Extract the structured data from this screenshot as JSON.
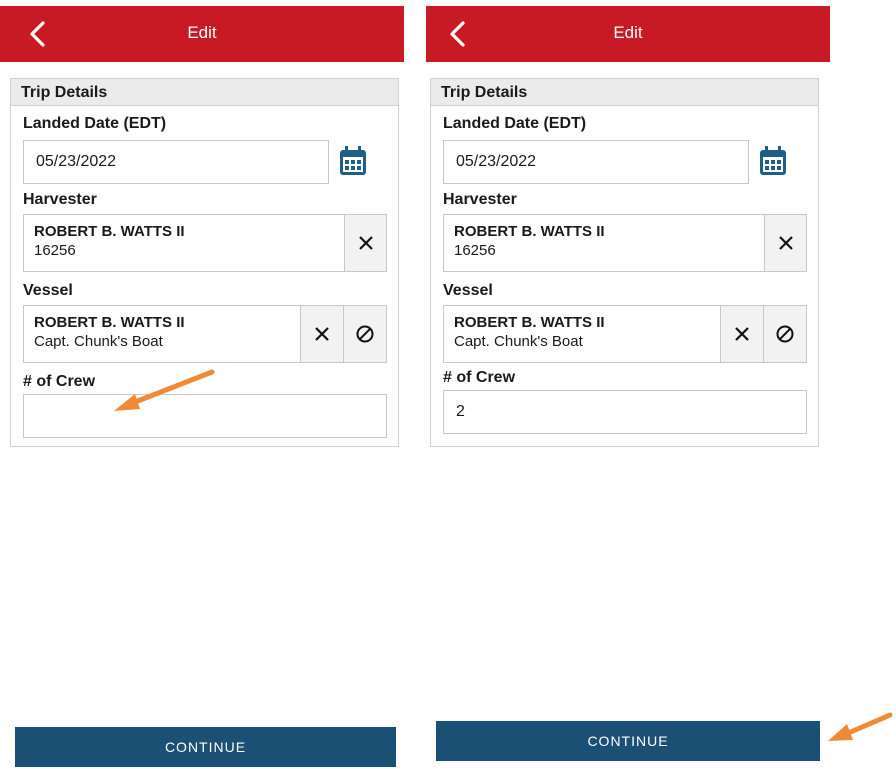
{
  "colors": {
    "header": "#c81a24",
    "continue": "#1b4f73",
    "calendar": "#1f5f86",
    "arrow": "#ef8a36"
  },
  "screens": [
    {
      "header_title": "Edit",
      "section_title": "Trip Details",
      "landed_label": "Landed Date (EDT)",
      "landed_value": "05/23/2022",
      "harvester_label": "Harvester",
      "harvester_name": "ROBERT B. WATTS II",
      "harvester_id": "16256",
      "vessel_label": "Vessel",
      "vessel_owner": "ROBERT B. WATTS II",
      "vessel_name": "Capt. Chunk's Boat",
      "crew_label": "# of Crew",
      "crew_value": "",
      "continue_label": "CONTINUE"
    },
    {
      "header_title": "Edit",
      "section_title": "Trip Details",
      "landed_label": "Landed Date (EDT)",
      "landed_value": "05/23/2022",
      "harvester_label": "Harvester",
      "harvester_name": "ROBERT B. WATTS II",
      "harvester_id": "16256",
      "vessel_label": "Vessel",
      "vessel_owner": "ROBERT B. WATTS II",
      "vessel_name": "Capt. Chunk's Boat",
      "crew_label": "# of Crew",
      "crew_value": "2",
      "continue_label": "CONTINUE"
    }
  ]
}
